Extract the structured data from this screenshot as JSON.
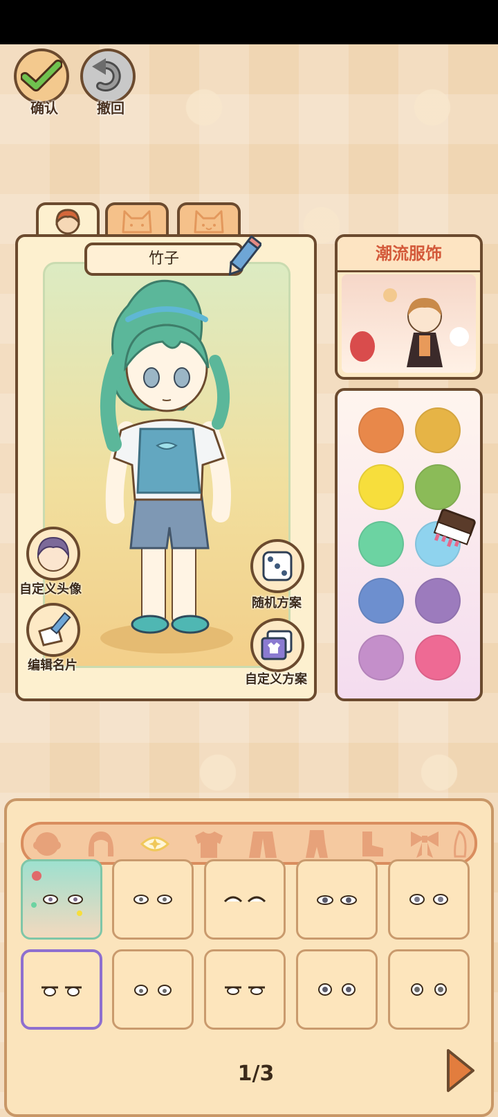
{
  "top_controls": {
    "confirm_label": "确认",
    "undo_label": "撤回"
  },
  "character_tabs": [
    "human-face",
    "cat-face",
    "cat-face-2"
  ],
  "character_card": {
    "name": "竹子",
    "custom_avatar_label": "自定义头像",
    "edit_card_label": "编辑名片",
    "random_outfit_label": "随机方案",
    "custom_outfit_label": "自定义方案"
  },
  "fashion_panel": {
    "title": "潮流服饰"
  },
  "palette": {
    "colors": [
      "#e8884a",
      "#e6b446",
      "#f7de3c",
      "#8bbb58",
      "#6cd3a2",
      "#8fd3ee",
      "#6d8fcf",
      "#9c7bbd",
      "#c48fca",
      "#ee6a94"
    ]
  },
  "category_bar": {
    "items": [
      "face-icon",
      "hair-icon",
      "eyes-icon",
      "top-icon",
      "coat-icon",
      "outfit-icon",
      "shoes-icon",
      "bow-icon"
    ],
    "selected": "eyes-icon"
  },
  "eye_grid": {
    "tiles": 10,
    "selected_index": 5
  },
  "pagination": {
    "page_text": "1/3"
  },
  "colors": {
    "outline": "#6b4a2e",
    "accent": "#d3593a",
    "selected_border": "#8e6fcf"
  }
}
